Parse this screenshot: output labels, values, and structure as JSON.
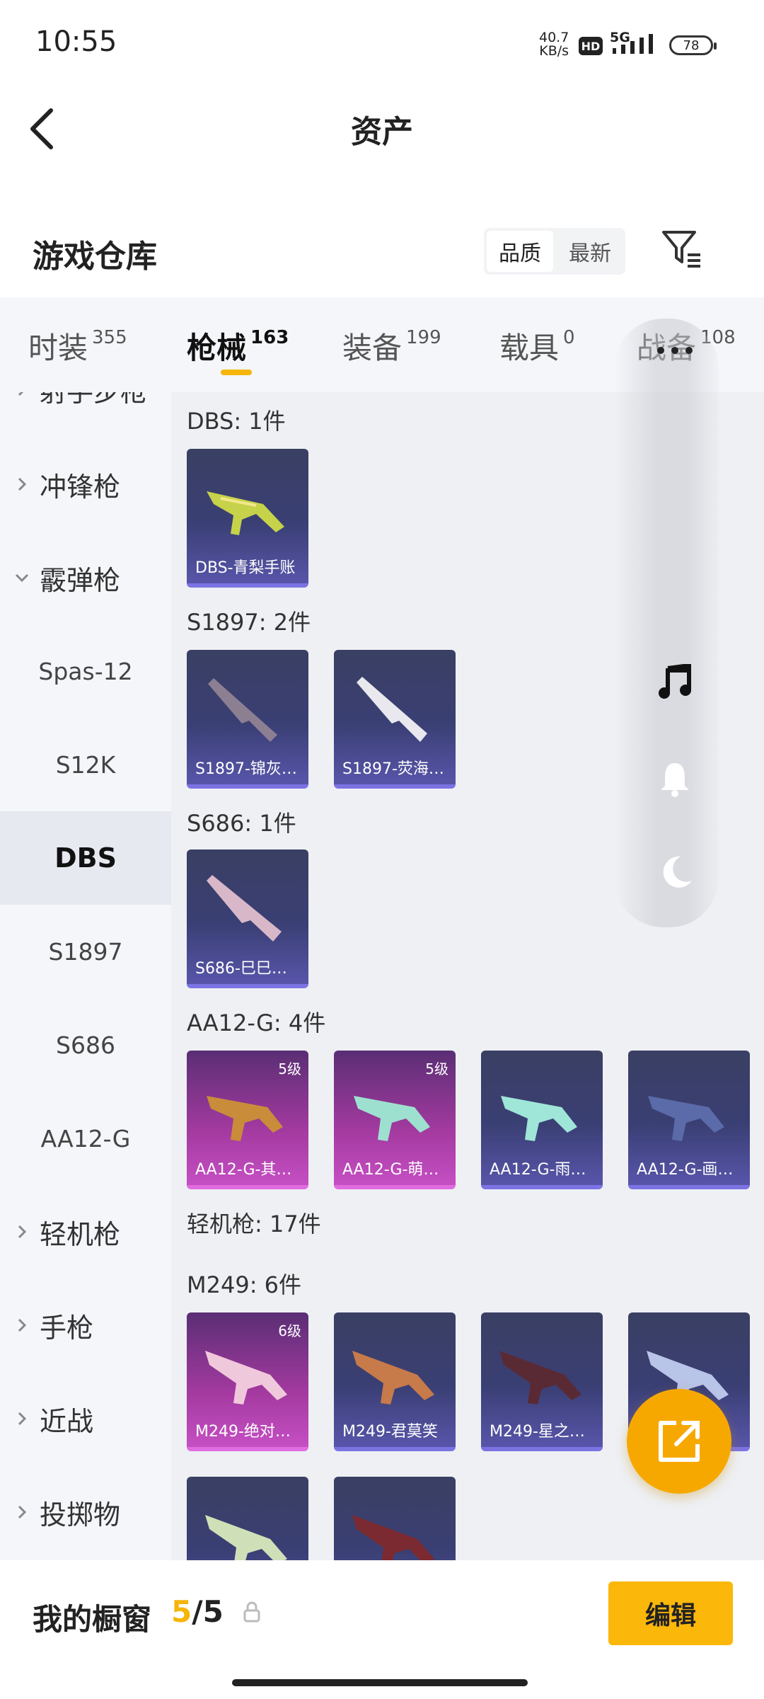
{
  "status": {
    "time": "10:55",
    "speed_value": "40.7",
    "speed_unit": "KB/s",
    "hd": "HD",
    "network": "5G",
    "battery": "78"
  },
  "nav": {
    "title": "资产"
  },
  "warehouse": {
    "title": "游戏仓库",
    "sort_quality": "品质",
    "sort_newest": "最新"
  },
  "tabs": [
    {
      "label": "时装",
      "count": "355"
    },
    {
      "label": "枪械",
      "count": "163"
    },
    {
      "label": "装备",
      "count": "199"
    },
    {
      "label": "载具",
      "count": "0"
    },
    {
      "label": "战备",
      "count": "108"
    }
  ],
  "sidebar": {
    "partial": "射手步枪",
    "smg": "冲锋枪",
    "shotgun": "霰弹枪",
    "sub": [
      "Spas-12",
      "S12K",
      "DBS",
      "S1897",
      "S686",
      "AA12-G"
    ],
    "lmg": "轻机枪",
    "pistol": "手枪",
    "melee": "近战",
    "throw": "投掷物"
  },
  "groups": {
    "dbs": "DBS: 1件",
    "s1897": "S1897: 2件",
    "s686": "S686: 1件",
    "aa12": "AA12-G: 4件",
    "lmg": "轻机枪: 17件",
    "m249": "M249: 6件"
  },
  "cards": {
    "dbs1": {
      "label": "DBS-青梨手账"
    },
    "s1897_1": {
      "label": "S1897-锦灰…"
    },
    "s1897_2": {
      "label": "S1897-荧海…"
    },
    "s686_1": {
      "label": "S686-巳巳…"
    },
    "aa12_1": {
      "label": "AA12-G-其…",
      "level": "5级"
    },
    "aa12_2": {
      "label": "AA12-G-萌…",
      "level": "5级"
    },
    "aa12_3": {
      "label": "AA12-G-雨…"
    },
    "aa12_4": {
      "label": "AA12-G-画…"
    },
    "m249_1": {
      "label": "M249-绝对…",
      "level": "6级"
    },
    "m249_2": {
      "label": "M249-君莫笑"
    },
    "m249_3": {
      "label": "M249-星之…"
    }
  },
  "bottom": {
    "title": "我的橱窗",
    "current": "5",
    "sep_total": "/5",
    "edit": "编辑"
  },
  "colors": {
    "accent": "#f5b50a",
    "card_purple": "#3a3f74",
    "card_pink": "#b043b0"
  },
  "icons": [
    "back-icon",
    "filter-icon",
    "more-dots-icon",
    "music-icon",
    "bell-icon",
    "moon-icon",
    "share-icon",
    "lock-icon"
  ]
}
